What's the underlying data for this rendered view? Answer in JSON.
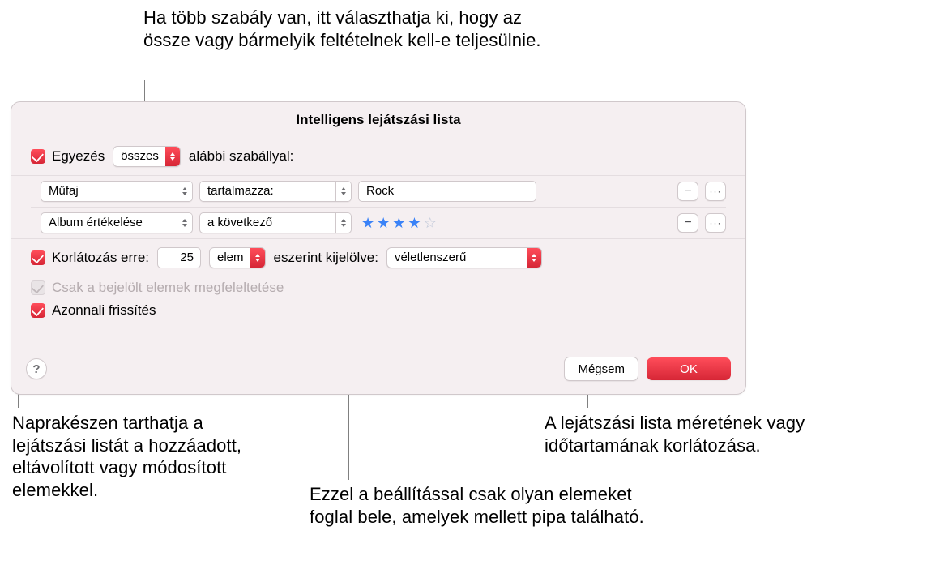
{
  "annotations": {
    "top": "Ha több szabály van, itt választhatja ki, hogy az össze vagy bármelyik feltételnek kell-e teljesülnie.",
    "bottom_left": "Naprakészen tarthatja a lejátszási listát a hozzáadott, eltávolított vagy módosított elemekkel.",
    "bottom_mid": "Ezzel a beállítással csak olyan elemeket foglal bele, amelyek mellett pipa található.",
    "bottom_right": "A lejátszási lista méretének vagy időtartamának korlátozása."
  },
  "panel": {
    "title": "Intelligens lejátszási lista",
    "match": {
      "checkbox_label": "Egyezés",
      "mode": "összes",
      "suffix": "alábbi szabállyal:"
    },
    "rules": [
      {
        "attribute": "Műfaj",
        "operator": "tartalmazza:",
        "value_type": "text",
        "value": "Rock"
      },
      {
        "attribute": "Album értékelése",
        "operator": "a következő",
        "value_type": "stars",
        "stars_filled": 4,
        "stars_total": 5
      }
    ],
    "limit": {
      "checkbox_label": "Korlátozás erre:",
      "count": "25",
      "unit": "elem",
      "by_label": "eszerint kijelölve:",
      "by_value": "véletlenszerű"
    },
    "only_checked": {
      "label": "Csak a bejelölt elemek megfeleltetése",
      "enabled": false
    },
    "live_update": {
      "label": "Azonnali frissítés",
      "checked": true
    },
    "buttons": {
      "help": "?",
      "cancel": "Mégsem",
      "ok": "OK",
      "minus": "−",
      "more": "···"
    }
  }
}
